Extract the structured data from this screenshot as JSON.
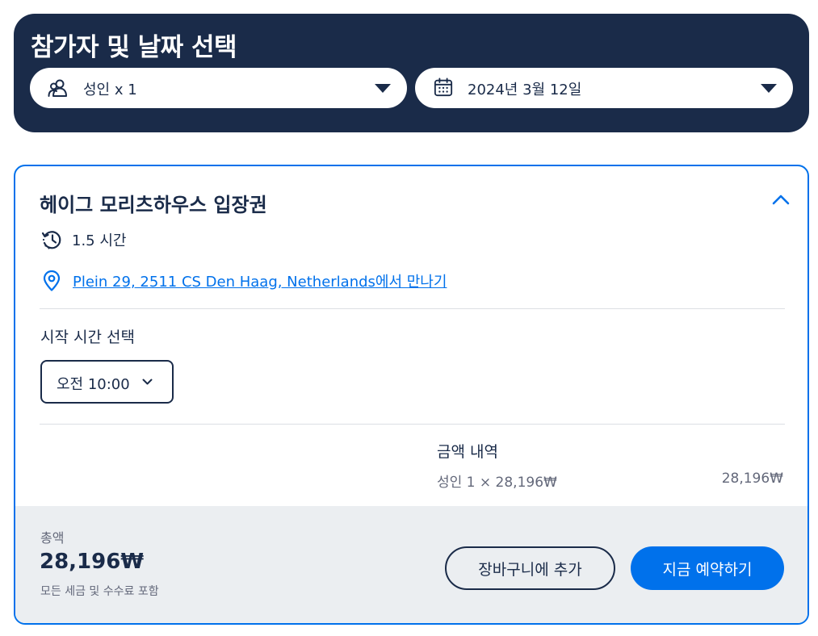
{
  "header": {
    "title": "참가자 및 날짜 선택",
    "participants": {
      "icon": "participants-icon",
      "label": "성인 x 1"
    },
    "date": {
      "icon": "calendar-icon",
      "label": "2024년 3월 12일"
    }
  },
  "option": {
    "title": "헤이그 모리츠하우스 입장권",
    "duration": {
      "icon": "clock-history-icon",
      "label": "1.5 시간"
    },
    "meeting_point": {
      "icon": "location-pin-icon",
      "address": "Plein 29, 2511 CS Den Haag, Netherlands",
      "suffix": "에서 만나기"
    },
    "start_time_label": "시작 시간 선택",
    "selected_time": "오전 10:00",
    "price_breakdown": {
      "label": "금액 내역",
      "line_label": "성인 1 × 28,196₩",
      "line_total": "28,196₩"
    },
    "footer": {
      "total_label": "총액",
      "total_amount": "28,196₩",
      "note": "모든 세금 및 수수료 포함",
      "add_to_cart": "장바구니에 추가",
      "book_now": "지금 예약하기"
    }
  },
  "colors": {
    "navy": "#1a2b49",
    "accent": "#0071eb",
    "footer_bg": "#ebeef1",
    "muted_text": "#63687a"
  }
}
